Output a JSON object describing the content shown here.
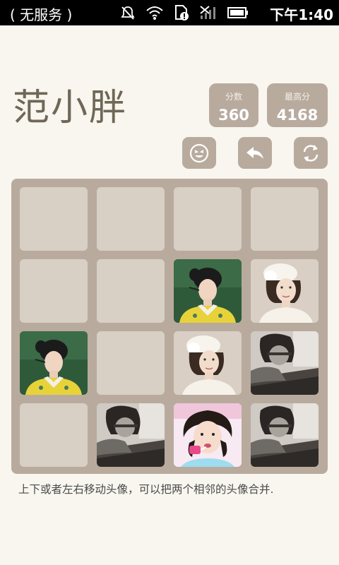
{
  "status_bar": {
    "carrier": "( 无服务 )",
    "time": "下午1:40",
    "icons": [
      "mute-icon",
      "wifi-icon",
      "sim-icon",
      "no-signal-icon",
      "battery-icon"
    ]
  },
  "header": {
    "title": "范小胖"
  },
  "scores": {
    "current_label": "分数",
    "current_value": "360",
    "best_label": "最高分",
    "best_value": "4168"
  },
  "actions": [
    "smiley-icon",
    "undo-icon",
    "restart-icon"
  ],
  "board": {
    "rows": 4,
    "cols": 4,
    "cells": [
      [
        "empty",
        "empty",
        "empty",
        "empty"
      ],
      [
        "empty",
        "empty",
        "portrait-yellow-dress",
        "portrait-white-hat"
      ],
      [
        "portrait-yellow-dress",
        "empty",
        "portrait-white-hat",
        "portrait-grey-warrior"
      ],
      [
        "empty",
        "portrait-grey-warrior",
        "portrait-pink-lollipop",
        "portrait-grey-warrior"
      ]
    ]
  },
  "footer": {
    "hint": "上下或者左右移动头像，可以把两个相邻的头像合并."
  },
  "colors": {
    "background": "#f8f6ef",
    "board": "#b8ab9e",
    "empty_cell": "#d8cfc5",
    "title": "#6f6757"
  }
}
